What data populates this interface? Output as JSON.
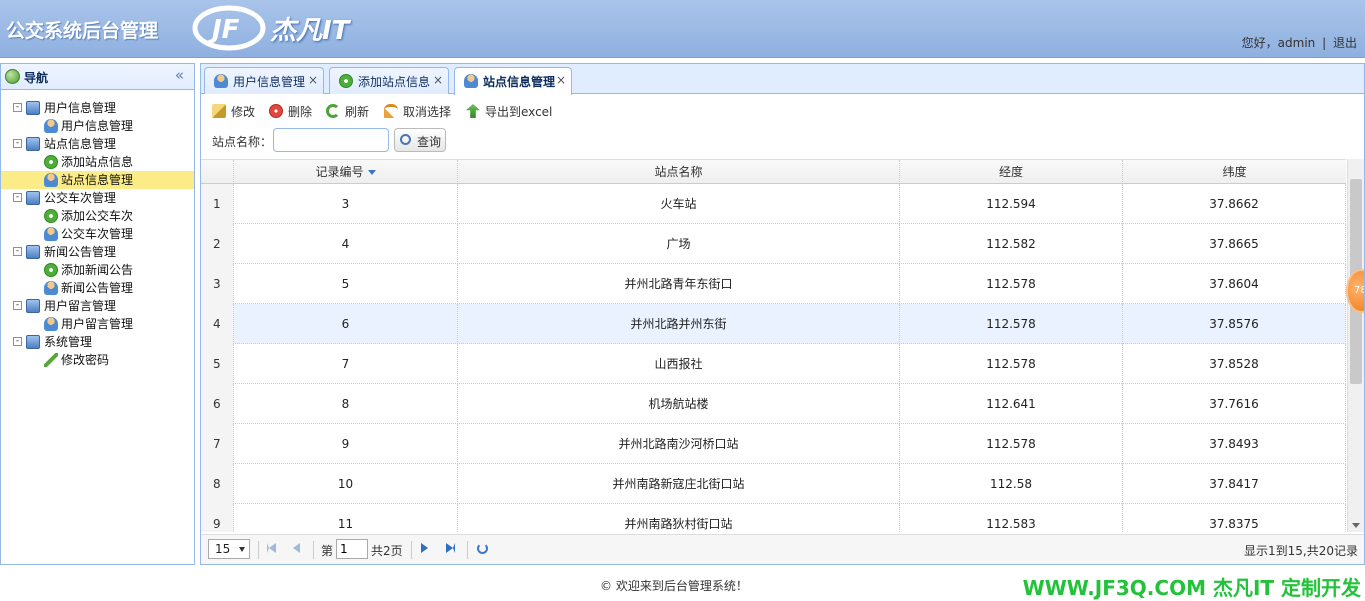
{
  "header": {
    "app_title": "公交系统后台管理",
    "logo_text": "杰凡IT",
    "greeting": "您好，admin",
    "separator": "|",
    "logout": "退出"
  },
  "nav": {
    "title": "导航",
    "collapse_glyph": "«",
    "tree": [
      {
        "label": "用户信息管理",
        "level": 0,
        "icon": "group-icon",
        "toggle": "-"
      },
      {
        "label": "用户信息管理",
        "level": 1,
        "icon": "user-icon"
      },
      {
        "label": "站点信息管理",
        "level": 0,
        "icon": "group-icon",
        "toggle": "-"
      },
      {
        "label": "添加站点信息",
        "level": 1,
        "icon": "add-icon"
      },
      {
        "label": "站点信息管理",
        "level": 1,
        "icon": "user-icon",
        "selected": true
      },
      {
        "label": "公交车次管理",
        "level": 0,
        "icon": "group-icon",
        "toggle": "-"
      },
      {
        "label": "添加公交车次",
        "level": 1,
        "icon": "add-icon"
      },
      {
        "label": "公交车次管理",
        "level": 1,
        "icon": "user-icon"
      },
      {
        "label": "新闻公告管理",
        "level": 0,
        "icon": "group-icon",
        "toggle": "-"
      },
      {
        "label": "添加新闻公告",
        "level": 1,
        "icon": "add-icon"
      },
      {
        "label": "新闻公告管理",
        "level": 1,
        "icon": "user-icon"
      },
      {
        "label": "用户留言管理",
        "level": 0,
        "icon": "group-icon",
        "toggle": "-"
      },
      {
        "label": "用户留言管理",
        "level": 1,
        "icon": "user-icon"
      },
      {
        "label": "系统管理",
        "level": 0,
        "icon": "group-icon",
        "toggle": "-"
      },
      {
        "label": "修改密码",
        "level": 1,
        "icon": "pen-icon"
      }
    ]
  },
  "tabs": [
    {
      "label": "用户信息管理",
      "close": "×"
    },
    {
      "label": "添加站点信息",
      "close": "×"
    },
    {
      "label": "站点信息管理",
      "close": "×",
      "active": true
    }
  ],
  "toolbar": {
    "edit": "修改",
    "delete": "删除",
    "refresh": "刷新",
    "cancel_select": "取消选择",
    "export": "导出到excel"
  },
  "search": {
    "label": "站点名称：",
    "value": "",
    "button": "查询"
  },
  "grid": {
    "columns": [
      "记录编号",
      "站点名称",
      "经度",
      "纬度"
    ],
    "rows": [
      {
        "n": "1",
        "id": "3",
        "name": "火车站",
        "lng": "112.594",
        "lat": "37.8662"
      },
      {
        "n": "2",
        "id": "4",
        "name": "广场",
        "lng": "112.582",
        "lat": "37.8665"
      },
      {
        "n": "3",
        "id": "5",
        "name": "并州北路青年东街口",
        "lng": "112.578",
        "lat": "37.8604"
      },
      {
        "n": "4",
        "id": "6",
        "name": "并州北路并州东街",
        "lng": "112.578",
        "lat": "37.8576"
      },
      {
        "n": "5",
        "id": "7",
        "name": "山西报社",
        "lng": "112.578",
        "lat": "37.8528"
      },
      {
        "n": "6",
        "id": "8",
        "name": "机场航站楼",
        "lng": "112.641",
        "lat": "37.7616"
      },
      {
        "n": "7",
        "id": "9",
        "name": "并州北路南沙河桥口站",
        "lng": "112.578",
        "lat": "37.8493"
      },
      {
        "n": "8",
        "id": "10",
        "name": "并州南路新寇庄北街口站",
        "lng": "112.58",
        "lat": "37.8417"
      },
      {
        "n": "9",
        "id": "11",
        "name": "并州南路狄村街口站",
        "lng": "112.583",
        "lat": "37.8375"
      }
    ],
    "badge": "78"
  },
  "pager": {
    "page_size": "15",
    "page_prefix": "第",
    "page_value": "1",
    "page_suffix": "共2页",
    "info": "显示1到15,共20记录"
  },
  "footer": {
    "copyright": "© 欢迎来到后台管理系统！",
    "watermark": "WWW.JF3Q.COM 杰凡IT  定制开发"
  },
  "colors": {
    "header": "#9bb9e4",
    "panel_border": "#95b8e7",
    "selected_row": "#fbec88",
    "watermark": "#22c23a"
  }
}
